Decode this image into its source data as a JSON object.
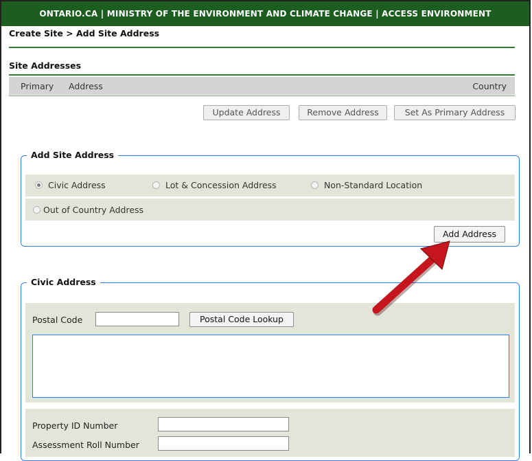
{
  "header": {
    "banner_text": "ONTARIO.CA  |  MINISTRY OF THE ENVIRONMENT AND CLIMATE CHANGE  |  ACCESS ENVIRONMENT"
  },
  "breadcrumb": "Create Site > Add Site Address",
  "site_addresses": {
    "title": "Site Addresses",
    "columns": {
      "primary": "Primary",
      "address": "Address",
      "country": "Country"
    },
    "buttons": {
      "update": "Update Address",
      "remove": "Remove Address",
      "set_primary": "Set As Primary Address"
    }
  },
  "add_site_address": {
    "legend": "Add Site Address",
    "options": [
      {
        "label": "Civic Address",
        "selected": true
      },
      {
        "label": "Lot & Concession Address",
        "selected": false
      },
      {
        "label": "Non-Standard Location",
        "selected": false
      },
      {
        "label": "Out of Country Address",
        "selected": false
      }
    ],
    "add_button": "Add Address"
  },
  "civic_address": {
    "legend": "Civic Address",
    "postal_code_label": "Postal Code",
    "postal_code_value": "",
    "lookup_button": "Postal Code Lookup",
    "property_id_label": "Property ID Number",
    "property_id_value": "",
    "assessment_roll_label": "Assessment Roll Number",
    "assessment_roll_value": ""
  },
  "colors": {
    "banner": "#1b5e20",
    "accent_border": "#2f80ed",
    "arrow": "#c4161c",
    "panel": "#e2e6d9"
  }
}
